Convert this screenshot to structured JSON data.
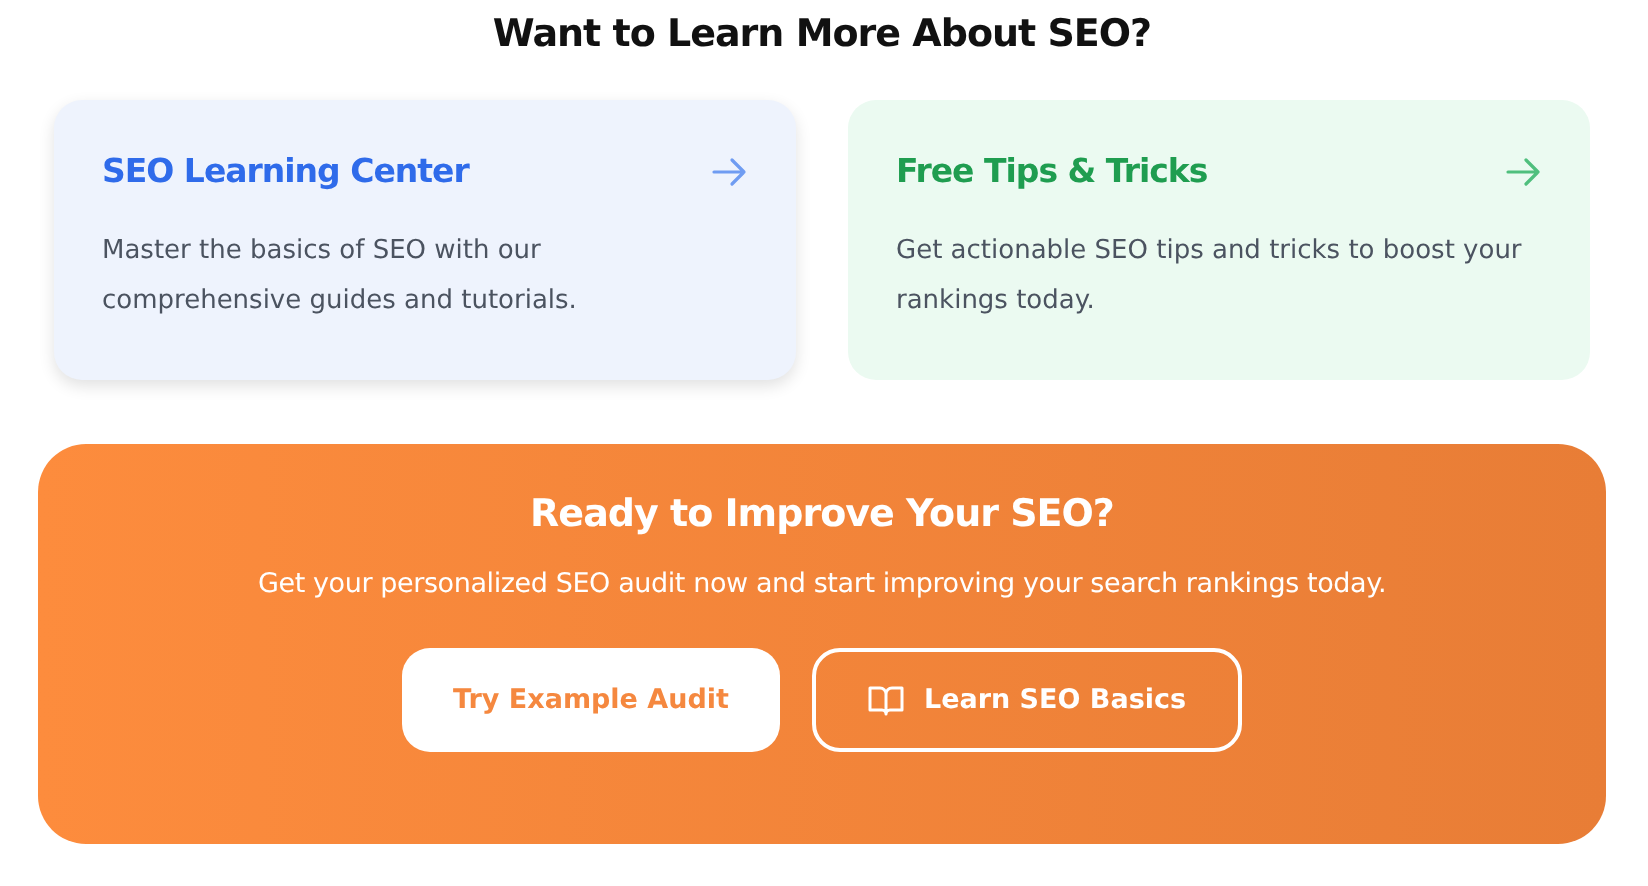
{
  "heading": "Want to Learn More About SEO?",
  "cards": [
    {
      "title": "SEO Learning Center",
      "description": "Master the basics of SEO with our comprehensive guides and tutorials.",
      "color": "#2f6bea",
      "kind": "blue",
      "highlighted": true
    },
    {
      "title": "Free Tips & Tricks",
      "description": "Get actionable SEO tips and tricks to boost your rankings today.",
      "color": "#1f9d50",
      "kind": "green",
      "highlighted": false
    }
  ],
  "cta": {
    "title": "Ready to Improve Your SEO?",
    "text": "Get your personalized SEO audit now and start improving your search rankings today.",
    "buttons": [
      {
        "label": "Try Example Audit",
        "kind": "solid"
      },
      {
        "label": "Learn SEO Basics",
        "kind": "outline"
      }
    ]
  }
}
